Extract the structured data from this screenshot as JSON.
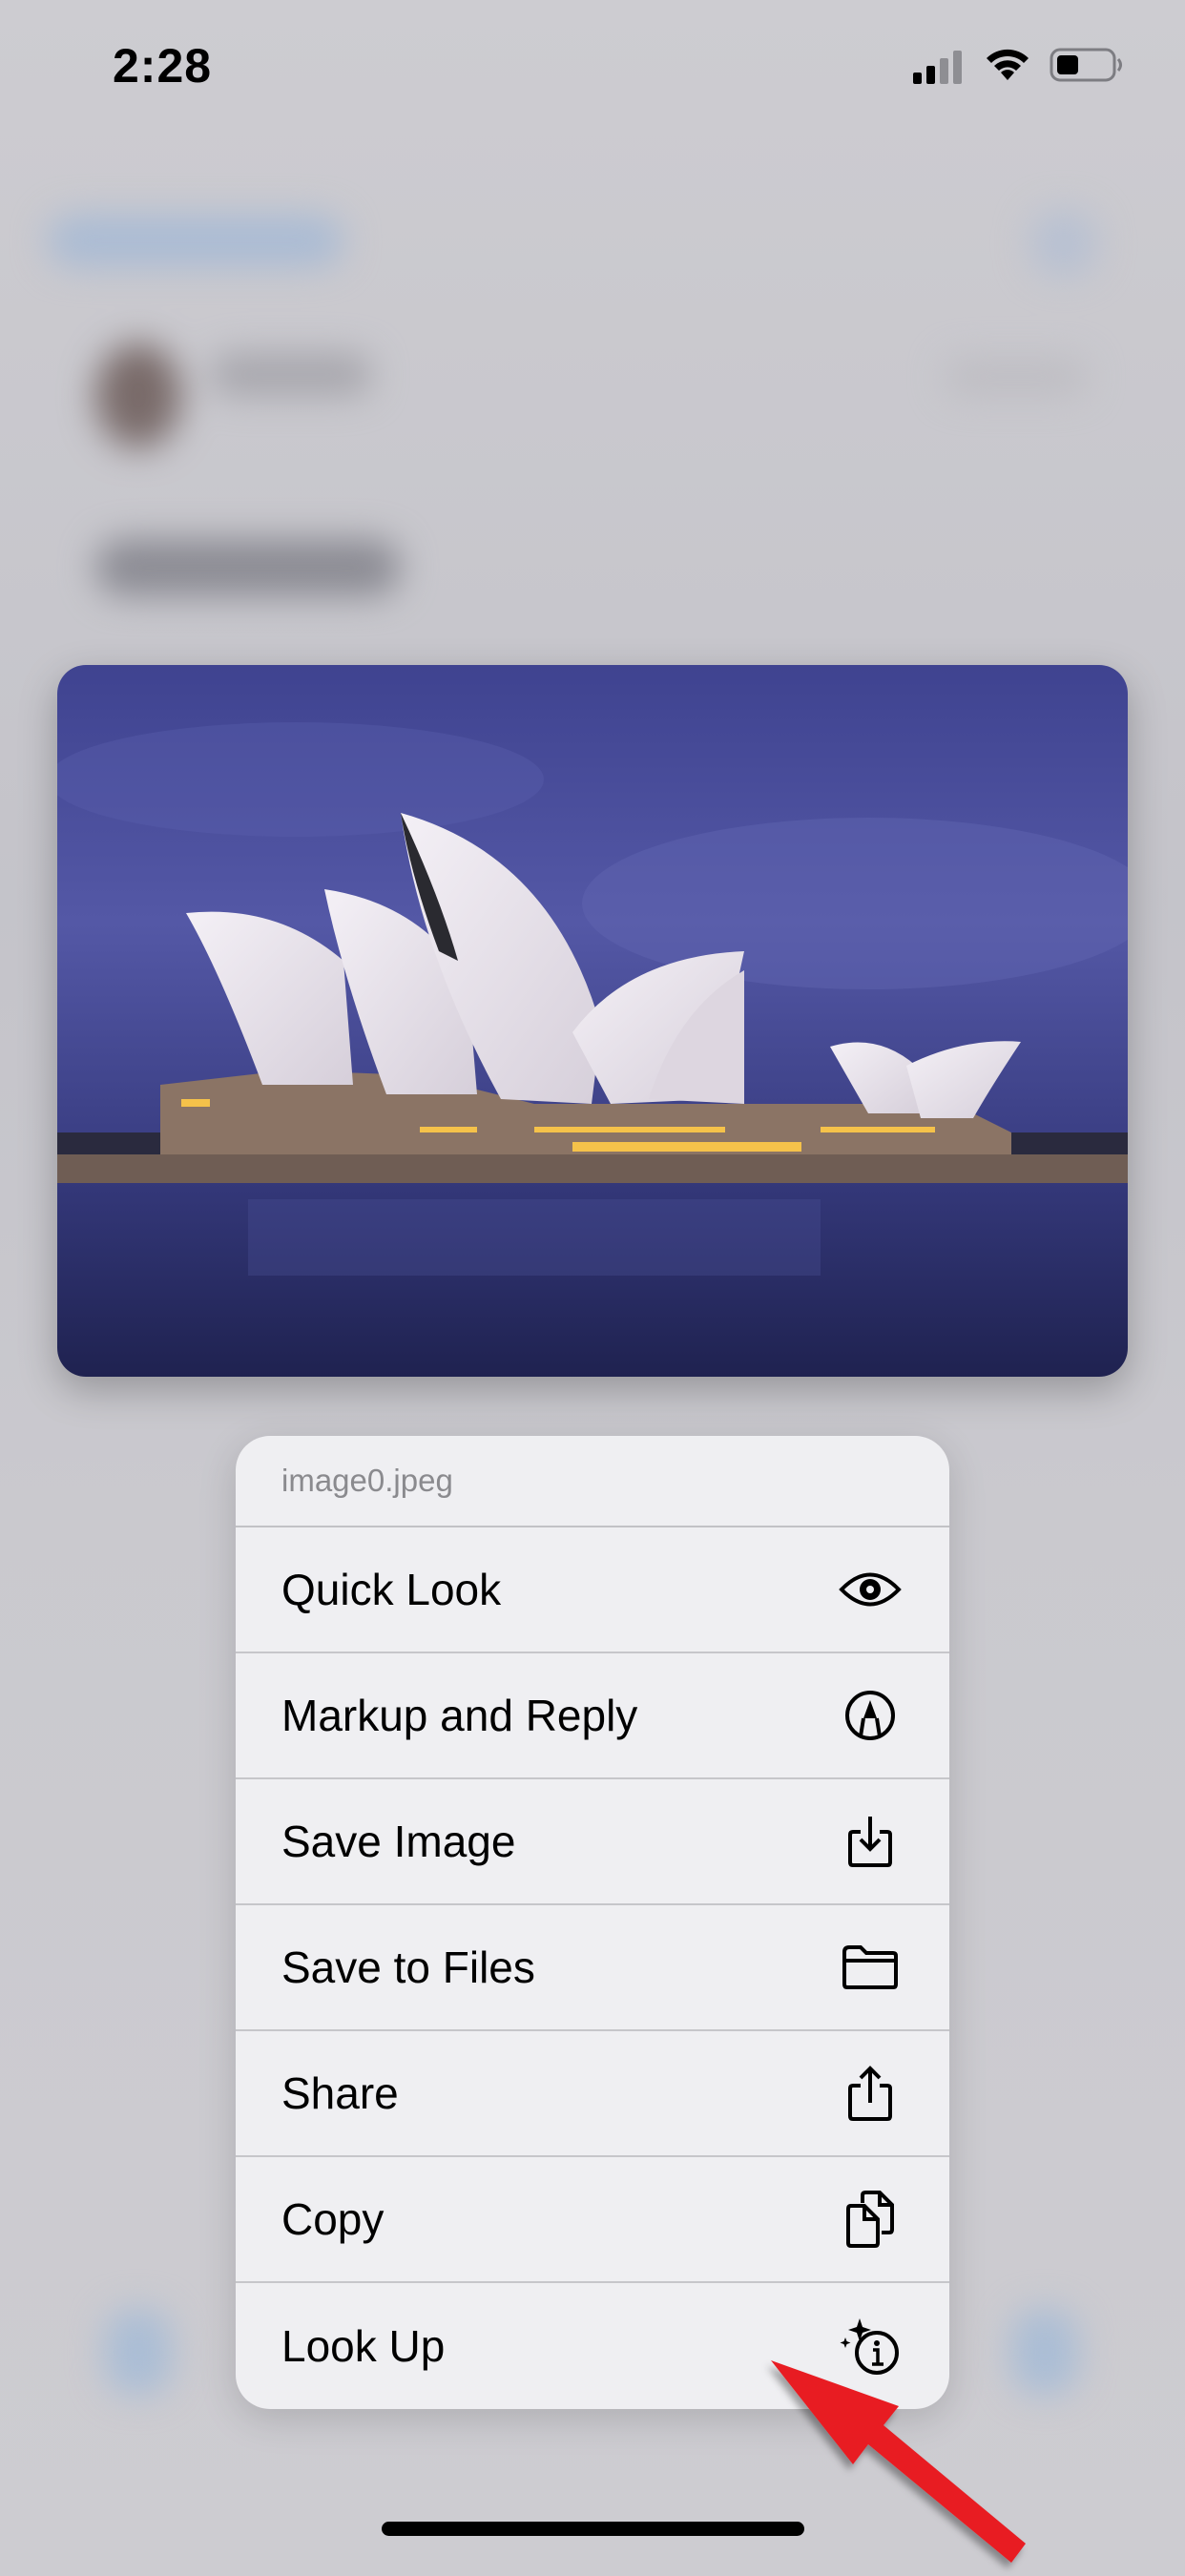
{
  "status_bar": {
    "time": "2:28",
    "signal_bars_filled": 2,
    "signal_bars_total": 4,
    "battery_level": 0.4,
    "icons": [
      "cellular-signal-icon",
      "wifi-icon",
      "battery-icon"
    ]
  },
  "preview": {
    "subject": "Sydney Opera House at dusk",
    "colors": {
      "sky": "#4a4f9a",
      "water": "#2a2e63",
      "shell": "#e9e4ec",
      "light": "#f5c24a"
    }
  },
  "context_menu": {
    "title": "image0.jpeg",
    "items": [
      {
        "label": "Quick Look",
        "icon": "eye-icon"
      },
      {
        "label": "Markup and Reply",
        "icon": "markup-pencil-icon"
      },
      {
        "label": "Save Image",
        "icon": "save-download-icon"
      },
      {
        "label": "Save to Files",
        "icon": "folder-icon"
      },
      {
        "label": "Share",
        "icon": "share-icon"
      },
      {
        "label": "Copy",
        "icon": "copy-documents-icon"
      },
      {
        "label": "Look Up",
        "icon": "visual-look-up-icon"
      }
    ]
  },
  "annotation": {
    "type": "arrow",
    "color": "#e81c24",
    "points_to": "Look Up"
  }
}
